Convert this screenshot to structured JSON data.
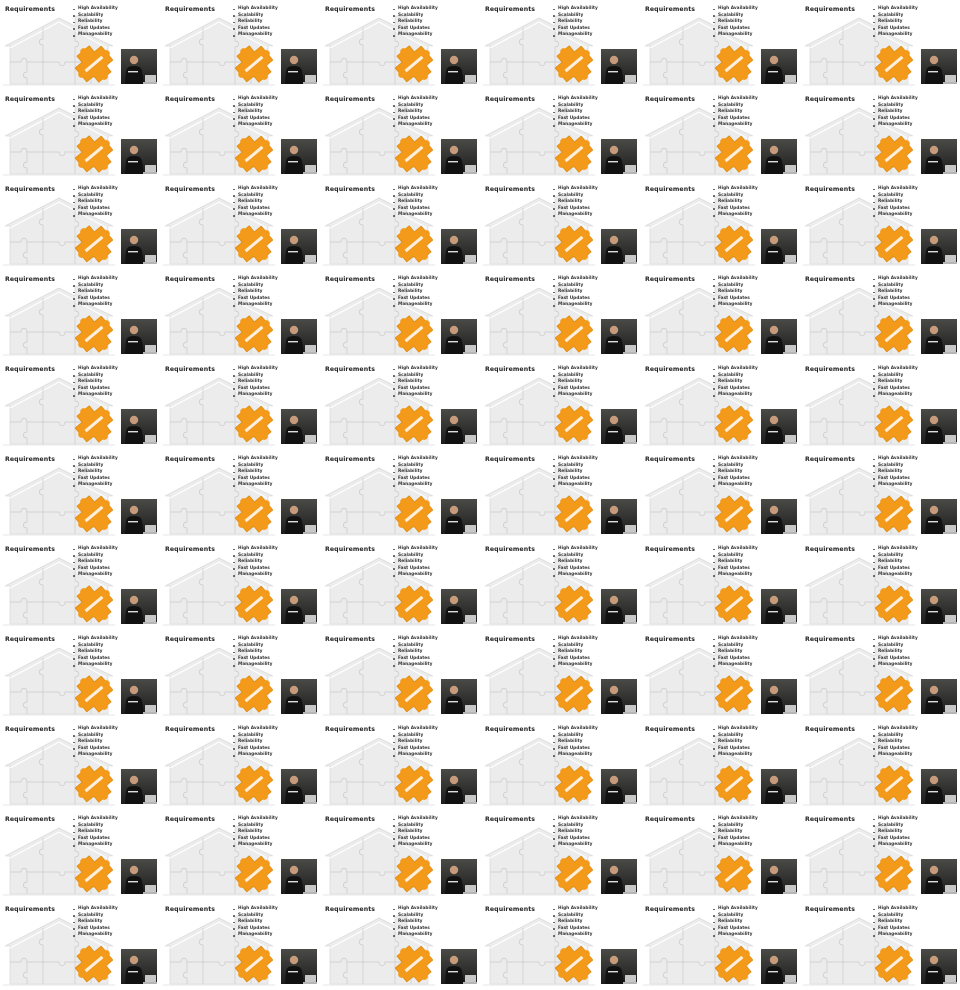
{
  "slide": {
    "title": "Requirements",
    "bullets": [
      "High Availability",
      "Scalability",
      "Reliability",
      "Fast Updates",
      "Manageability"
    ]
  },
  "grid": {
    "columns": 6,
    "rows": 11
  },
  "icons": {
    "house": "house-puzzle-image",
    "piece": "puzzle-piece-image",
    "photo": "speaker-photo"
  },
  "colors": {
    "puzzle_orange": "#f39a1a",
    "house_gray": "#eeeeee",
    "photo_dark": "#2a2a2a"
  }
}
